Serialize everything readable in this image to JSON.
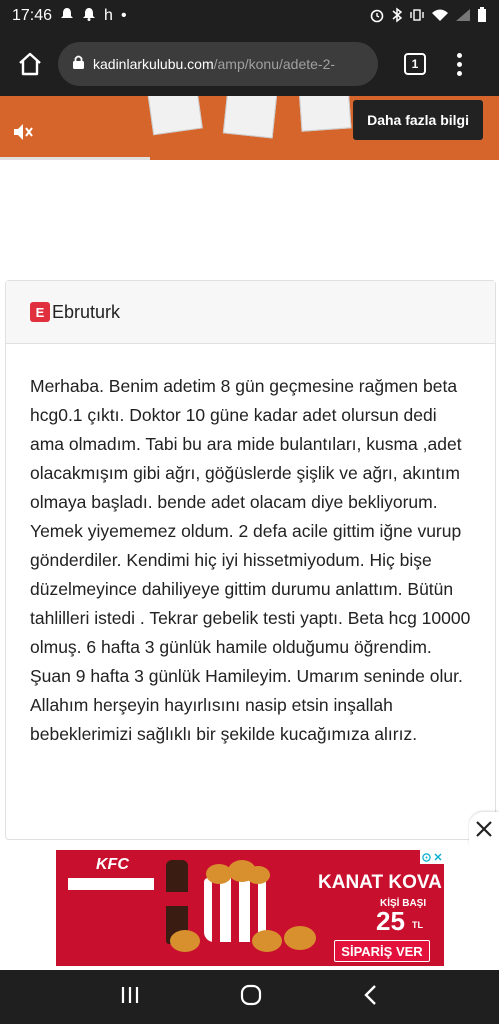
{
  "status_bar": {
    "time": "17:46",
    "indicator": "h"
  },
  "browser": {
    "url_host": "kadinlarkulubu.com",
    "url_path": "/amp/konu/adete-2-",
    "tab_count": "1"
  },
  "top_ad": {
    "more_info_label": "Daha fazla bilgi",
    "progress": 0.3
  },
  "post": {
    "avatar_letter": "E",
    "username": "Ebruturk",
    "body": "Merhaba. Benim adetim 8 gün geçmesine rağmen beta hcg0.1 çıktı. Doktor 10 güne kadar adet olursun dedi ama olmadım. Tabi bu ara mide bulantıları, kusma ,adet olacakmışım gibi ağrı, göğüslerde şişlik ve ağrı, akıntım olmaya başladı. bende adet olacam diye bekliyorum. Yemek yiyememez oldum. 2 defa acile gittim iğne vurup gönderdiler. Kendimi hiç iyi hissetmiyodum. Hiç bişe düzelmeyince dahiliyeye gittim durumu anlattım. Bütün tahlilleri istedi . Tekrar gebelik testi yaptı. Beta hcg 10000 olmuş. 6 hafta 3 günlük hamile olduğumu öğrendim. Şuan 9 hafta 3 günlük Hamileyim. Umarım seninde olur. Allahım herşeyin hayırlısını nasip etsin inşallah bebeklerimizi sağlıklı bir şekilde kucağımıza alırız."
  },
  "bottom_ad": {
    "brand": "KFC",
    "title": "KANAT KOVA",
    "per_person": "KİŞİ BAŞI",
    "price": "25",
    "currency": "TL",
    "cta": "SİPARİŞ VER"
  },
  "colors": {
    "ad_orange": "#d5652b",
    "kfc_red": "#c8102e",
    "avatar_red": "#e0303d"
  }
}
